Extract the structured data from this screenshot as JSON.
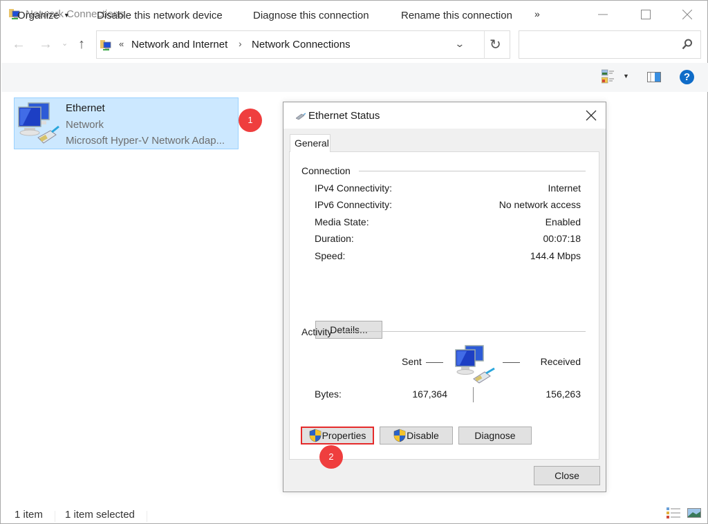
{
  "window": {
    "title": "Network Connections",
    "controls": {
      "minimize": "minimize",
      "maximize": "maximize",
      "close": "close"
    }
  },
  "nav": {
    "back_icon": "arrow-left-icon",
    "forward_icon": "arrow-right-icon",
    "recent_icon": "chevron-down-icon",
    "up_icon": "arrow-up-icon"
  },
  "address": {
    "overflow": "«",
    "breadcrumbs": [
      "Network and Internet",
      "Network Connections"
    ],
    "separator": "›",
    "refresh_icon": "refresh-icon"
  },
  "search": {
    "placeholder": "",
    "value": ""
  },
  "commandbar": {
    "organize": "Organize",
    "disable": "Disable this network device",
    "diagnose": "Diagnose this connection",
    "rename": "Rename this connection",
    "more": "»",
    "help": "?"
  },
  "item": {
    "name": "Ethernet",
    "type": "Network",
    "description": "Microsoft Hyper-V Network Adap..."
  },
  "annotations": {
    "step1": "1",
    "step2": "2",
    "color": "#ef3e3e"
  },
  "dialog": {
    "title": "Ethernet Status",
    "tab": "General",
    "connection": {
      "label": "Connection",
      "rows": [
        {
          "label": "IPv4 Connectivity:",
          "value": "Internet"
        },
        {
          "label": "IPv6 Connectivity:",
          "value": "No network access"
        },
        {
          "label": "Media State:",
          "value": "Enabled"
        },
        {
          "label": "Duration:",
          "value": "00:07:18"
        },
        {
          "label": "Speed:",
          "value": "144.4 Mbps"
        }
      ],
      "details_button": "Details..."
    },
    "activity": {
      "label": "Activity",
      "sent_label": "Sent",
      "received_label": "Received",
      "bytes_label": "Bytes:",
      "bytes_sent": "167,364",
      "bytes_received": "156,263"
    },
    "buttons": {
      "properties": "Properties",
      "disable": "Disable",
      "diagnose": "Diagnose",
      "close": "Close"
    }
  },
  "status": {
    "count": "1 item",
    "selected": "1 item selected"
  },
  "colors": {
    "selection_bg": "#cce8ff",
    "selection_border": "#99d1ff",
    "help_blue": "#0f6cc8",
    "highlight_red": "#e52a2a"
  }
}
